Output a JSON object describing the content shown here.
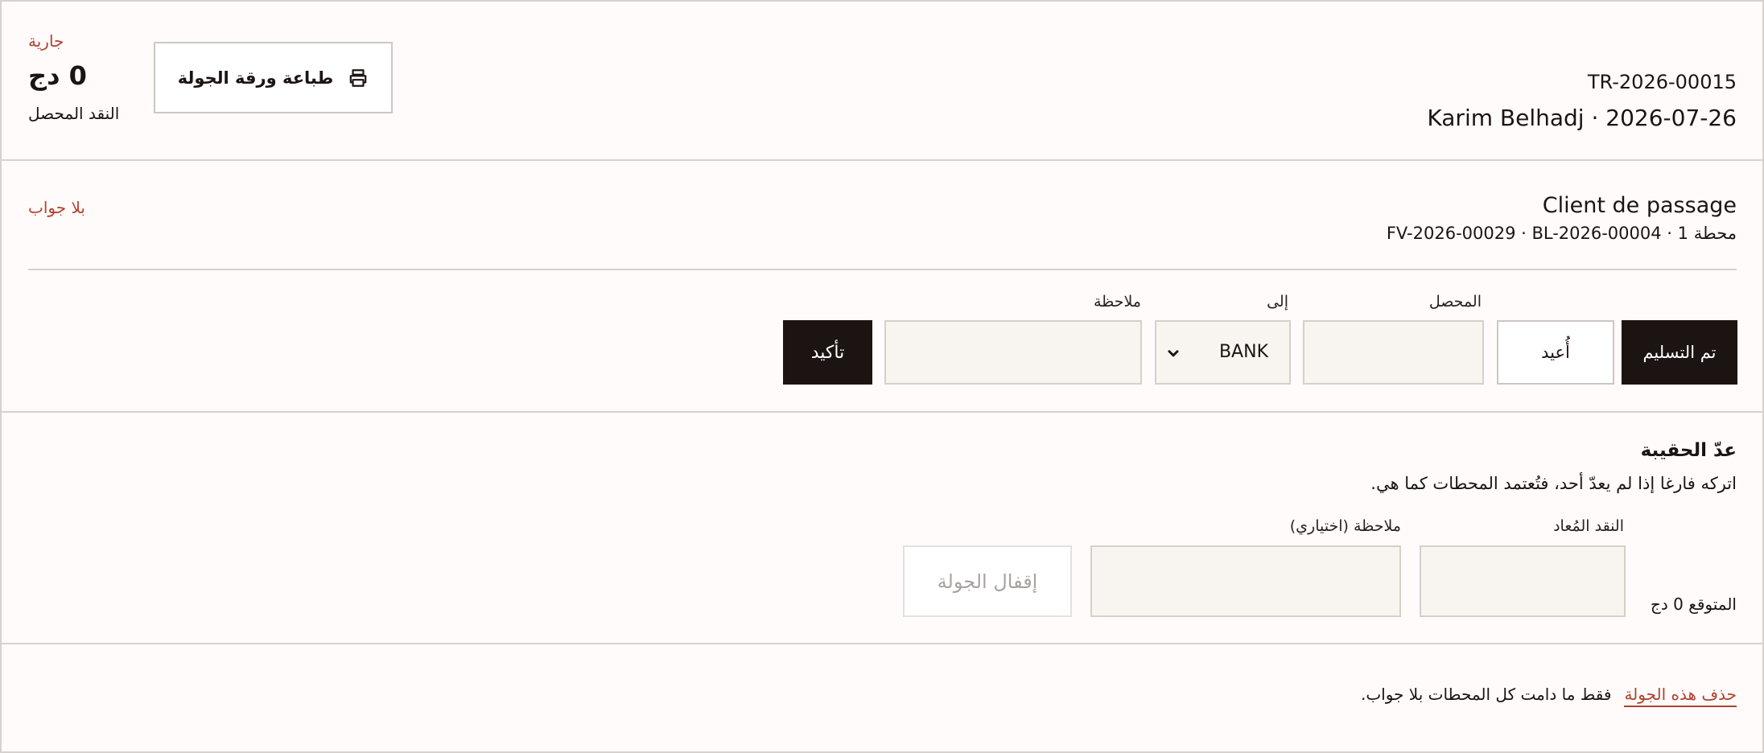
{
  "tour": {
    "status": "جارية",
    "cash_amount": "0 دج",
    "cash_label": "النقد المحصل",
    "print_label": "طباعة ورقة الجولة",
    "code": "TR-2026-00015",
    "driver_date": "Karim Belhadj · 2026-07-26"
  },
  "stop": {
    "client": "Client de passage",
    "ref": "محطة 1 · FV-2026-00029 · BL-2026-00004",
    "status": "بلا جواب",
    "delivered_label": "تم التسليم",
    "returned_label": "أُعيد",
    "collected_label": "المحصل",
    "collected_value": "",
    "to_label": "إلى",
    "to_value": "BANK",
    "note_label": "ملاحظة",
    "note_value": "",
    "confirm_label": "تأكيد"
  },
  "bag": {
    "title": "عدّ الحقيبة",
    "hint": "اتركه فارغا إذا لم يعدّ أحد، فتُعتمد المحطات كما هي.",
    "expected": "المتوقع 0 دج",
    "returned_cash_label": "النقد المُعاد",
    "returned_cash_value": "",
    "optional_note_label": "ملاحظة (اختياري)",
    "optional_note_value": "",
    "close_label": "إقفال الجولة"
  },
  "danger": {
    "delete_label": "حذف هذه الجولة",
    "delete_hint": "فقط ما دامت كل المحطات بلا جواب."
  }
}
